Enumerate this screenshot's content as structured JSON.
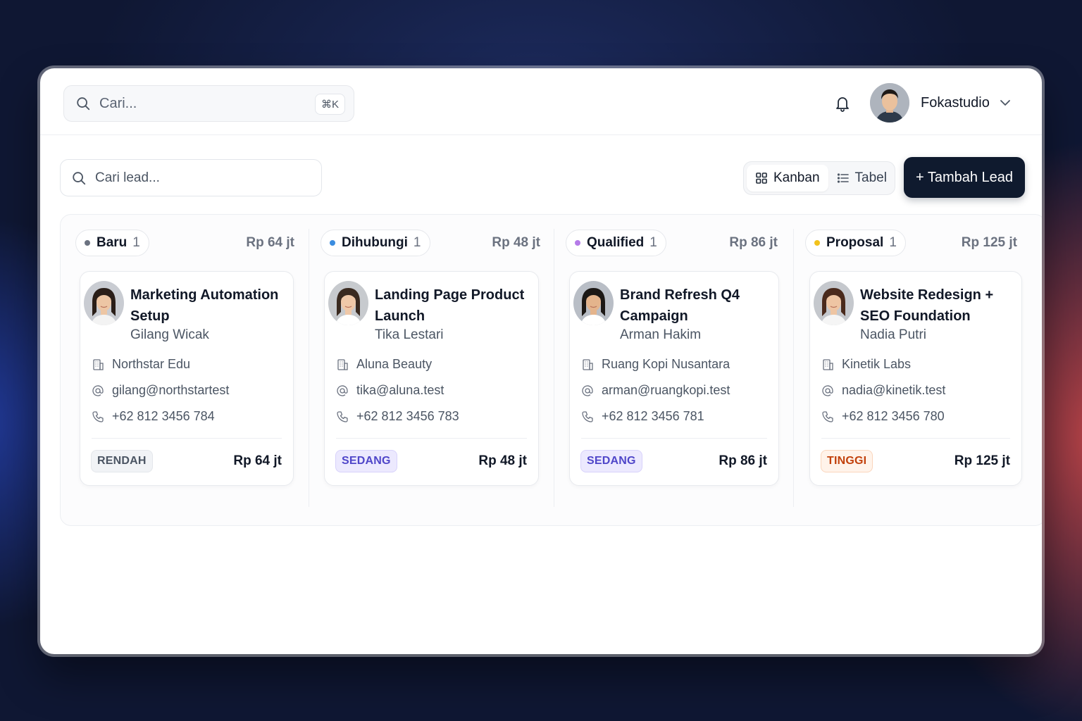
{
  "topbar": {
    "search_placeholder": "Cari...",
    "search_shortcut": "⌘K",
    "user_name": "Fokastudio"
  },
  "toolbar": {
    "lead_search_placeholder": "Cari lead...",
    "view_kanban": "Kanban",
    "view_table": "Tabel",
    "active_view": "Kanban",
    "add_button": "+ Tambah Lead"
  },
  "columns": [
    {
      "name": "Baru",
      "count": "1",
      "total": "Rp 64 jt",
      "dot_color": "#6b7280",
      "card": {
        "title": "Marketing Automation Setup",
        "person": "Gilang Wicak",
        "company": "Northstar Edu",
        "email": "gilang@northstartest",
        "phone": "+62 812 3456 784",
        "priority": "RENDAH",
        "amount": "Rp 64 jt"
      }
    },
    {
      "name": "Dihubungi",
      "count": "1",
      "total": "Rp 48 jt",
      "dot_color": "#3b8de0",
      "card": {
        "title": "Landing Page Product Launch",
        "person": "Tika Lestari",
        "company": "Aluna Beauty",
        "email": "tika@aluna.test",
        "phone": "+62 812 3456 783",
        "priority": "SEDANG",
        "amount": "Rp 48 jt"
      }
    },
    {
      "name": "Qualified",
      "count": "1",
      "total": "Rp 86 jt",
      "dot_color": "#b57be8",
      "card": {
        "title": "Brand Refresh Q4 Campaign",
        "person": "Arman Hakim",
        "company": "Ruang Kopi Nusantara",
        "email": "arman@ruangkopi.test",
        "phone": "+62 812 3456 781",
        "priority": "SEDANG",
        "amount": "Rp 86 jt"
      }
    },
    {
      "name": "Proposal",
      "count": "1",
      "total": "Rp 125 jt",
      "dot_color": "#f2c21b",
      "card": {
        "title": "Website Redesign + SEO Foundation",
        "person": "Nadia Putri",
        "company": "Kinetik Labs",
        "email": "nadia@kinetik.test",
        "phone": "+62 812 3456 780",
        "priority": "TINGGI",
        "amount": "Rp 125 jt"
      }
    }
  ]
}
